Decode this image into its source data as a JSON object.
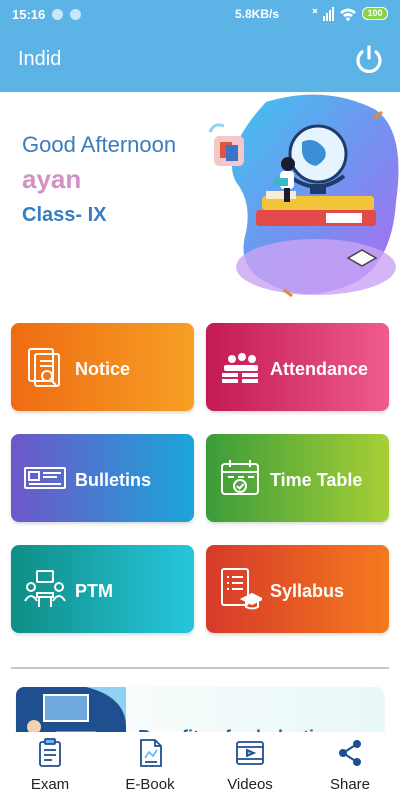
{
  "status_bar": {
    "time": "15:16",
    "network_speed": "5.8KB/s",
    "battery": "100",
    "colors": {
      "background": "#5bb3e6",
      "battery": "#8ad14d"
    }
  },
  "app_bar": {
    "title": "Indid",
    "power_icon": "power-icon",
    "background": "#5bb3e6"
  },
  "hero": {
    "greeting": "Good Afternoon",
    "username": "ayan",
    "class_label": "Class- IX"
  },
  "tiles": [
    {
      "label": "Notice",
      "icon": "notice-document-icon"
    },
    {
      "label": "Attendance",
      "icon": "attendance-students-icon"
    },
    {
      "label": "Bulletins",
      "icon": "bulletin-board-icon"
    },
    {
      "label": "Time Table",
      "icon": "calendar-check-icon"
    },
    {
      "label": "PTM",
      "icon": "meeting-people-icon"
    },
    {
      "label": "Syllabus",
      "icon": "syllabus-list-icon"
    }
  ],
  "banner": {
    "text": "Benefits of scholastic"
  },
  "bottom_nav": {
    "items": [
      {
        "label": "Exam",
        "icon": "exam-icon"
      },
      {
        "label": "E-Book",
        "icon": "ebook-icon"
      },
      {
        "label": "Videos",
        "icon": "video-player-icon"
      },
      {
        "label": "Share",
        "icon": "share-icon"
      }
    ]
  }
}
